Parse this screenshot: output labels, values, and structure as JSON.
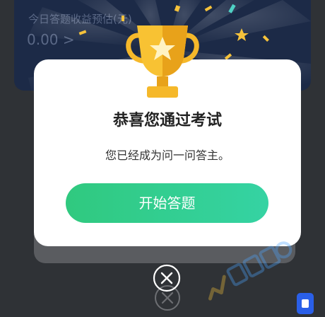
{
  "background": {
    "card_label": "今日答题收益预估(元)",
    "card_amount": "0.00 >"
  },
  "modal": {
    "title": "恭喜您通过考试",
    "subtitle": "您已经成为问一问答主。",
    "start_button": "开始答题"
  },
  "icons": {
    "trophy": "trophy-icon",
    "close": "close-icon",
    "watermark": "watermark-logo",
    "corner": "chat-icon"
  },
  "colors": {
    "accent_start": "#30c97f",
    "accent_end": "#35d3a3",
    "trophy_gold": "#f5b82a",
    "overlay_card": "#1c2a47"
  }
}
